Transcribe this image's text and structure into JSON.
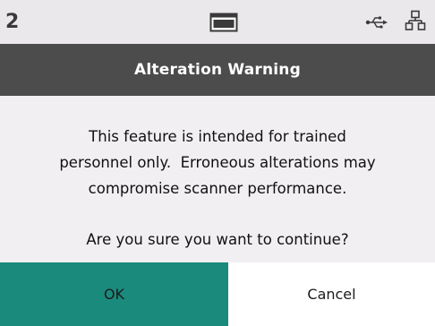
{
  "status_bar": {
    "page_number": "2",
    "icons": [
      "display-icon",
      "usb-icon",
      "network-icon"
    ]
  },
  "dialog": {
    "title": "Alteration Warning",
    "message_lines": [
      "This feature is intended for trained",
      "personnel only.  Erroneous alterations may",
      "compromise scanner performance."
    ],
    "question": "Are you sure you want to continue?"
  },
  "buttons": {
    "ok_label": "OK",
    "cancel_label": "Cancel"
  },
  "colors": {
    "title_bar": "#4c4c4c",
    "ok_button": "#1a8a7d",
    "status_bar": "#ebe8ec",
    "body_background": "#f2eff2"
  }
}
